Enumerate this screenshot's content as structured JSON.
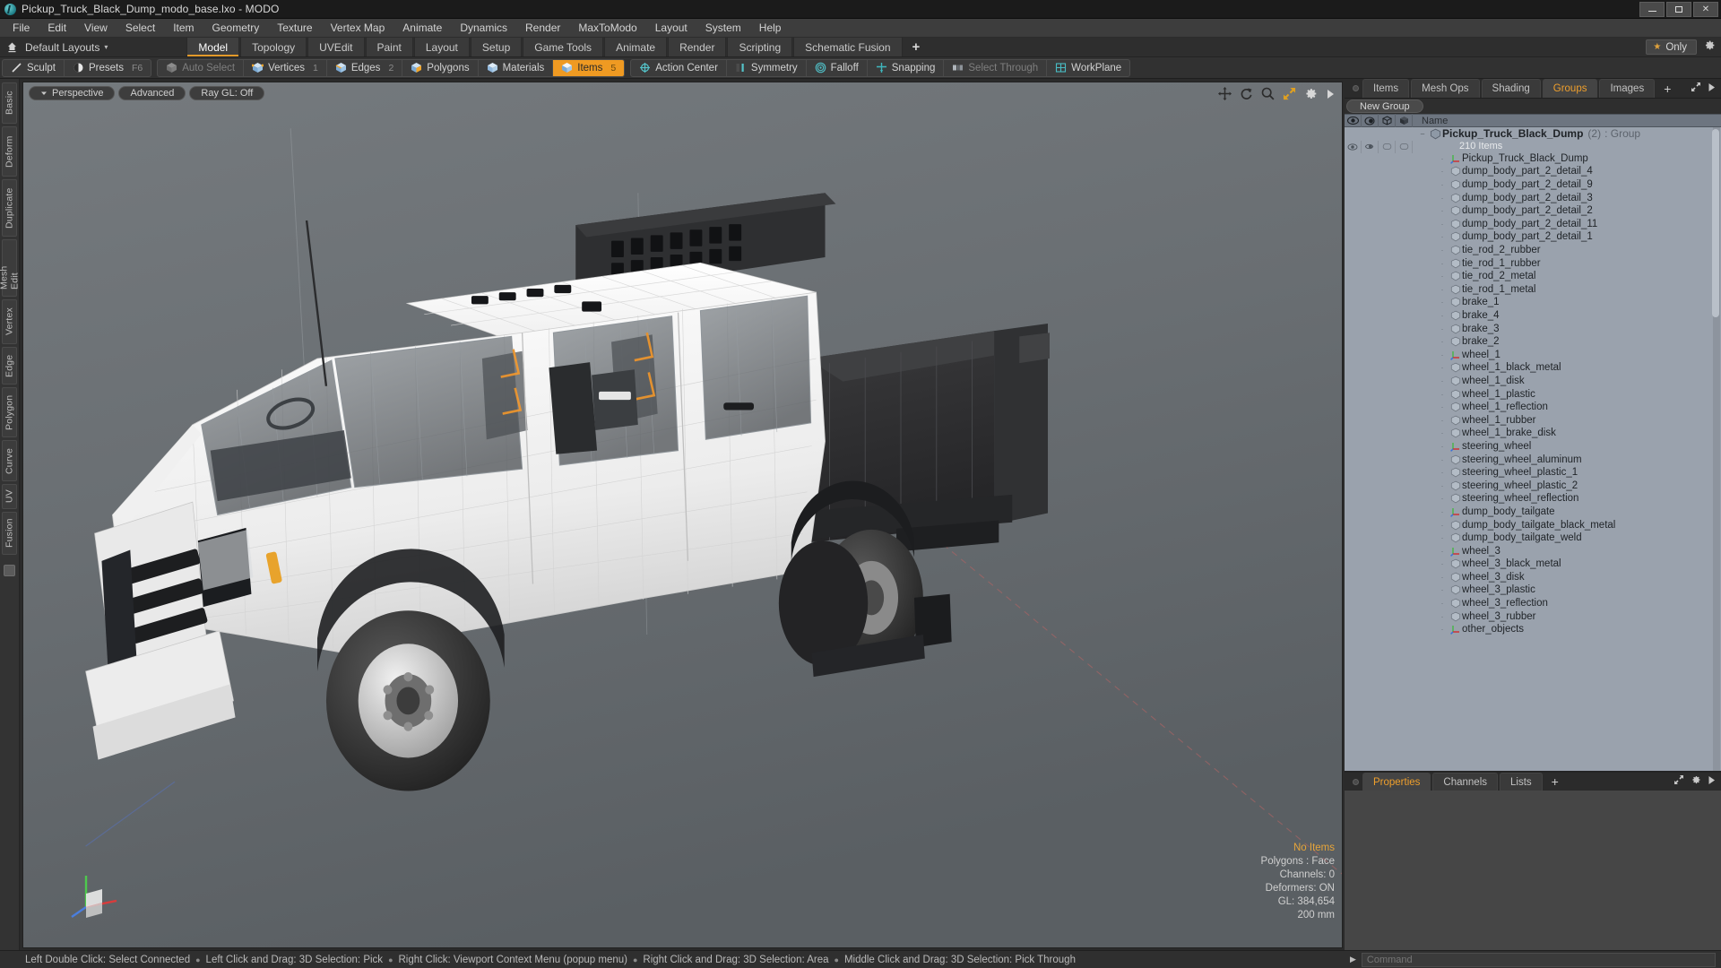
{
  "window": {
    "title": "Pickup_Truck_Black_Dump_modo_base.lxo - MODO",
    "app_icon": "modo-logo-icon",
    "minimize_label": "",
    "maximize_label": "",
    "close_label": "✕"
  },
  "menubar": {
    "items": [
      {
        "label": "File"
      },
      {
        "label": "Edit"
      },
      {
        "label": "View"
      },
      {
        "label": "Select"
      },
      {
        "label": "Item"
      },
      {
        "label": "Geometry"
      },
      {
        "label": "Texture"
      },
      {
        "label": "Vertex Map"
      },
      {
        "label": "Animate"
      },
      {
        "label": "Dynamics"
      },
      {
        "label": "Render"
      },
      {
        "label": "MaxToModo"
      },
      {
        "label": "Layout"
      },
      {
        "label": "System"
      },
      {
        "label": "Help"
      }
    ]
  },
  "layoutbar": {
    "home_icon": "home-icon",
    "layouts_label": "Default Layouts",
    "layouts_caret": "▾",
    "tabs": [
      {
        "label": "Model",
        "active": true
      },
      {
        "label": "Topology",
        "active": false
      },
      {
        "label": "UVEdit",
        "active": false
      },
      {
        "label": "Paint",
        "active": false
      },
      {
        "label": "Layout",
        "active": false
      },
      {
        "label": "Setup",
        "active": false
      },
      {
        "label": "Game Tools",
        "active": false
      },
      {
        "label": "Animate",
        "active": false
      },
      {
        "label": "Render",
        "active": false
      },
      {
        "label": "Scripting",
        "active": false
      },
      {
        "label": "Schematic Fusion",
        "active": false
      }
    ],
    "add_tab_label": "+",
    "only_label": "Only",
    "only_star": "★",
    "gear_icon": "gear-icon"
  },
  "modebar": {
    "groups": [
      {
        "buttons": [
          {
            "label": "Sculpt",
            "icon": "sculpt-pencil-icon",
            "shortcut": "",
            "state": "normal"
          },
          {
            "label": "Presets",
            "icon": "presets-sphere-icon",
            "shortcut": "F6",
            "state": "normal"
          }
        ]
      },
      {
        "buttons": [
          {
            "label": "Auto Select",
            "icon": "cube-grey-icon",
            "shortcut": "",
            "state": "dim"
          },
          {
            "label": "Vertices",
            "icon": "cube-vertices-icon",
            "shortcut": "1",
            "state": "normal"
          },
          {
            "label": "Edges",
            "icon": "cube-edges-icon",
            "shortcut": "2",
            "state": "normal"
          },
          {
            "label": "Polygons",
            "icon": "cube-polygons-icon",
            "shortcut": "",
            "state": "normal"
          },
          {
            "label": "Materials",
            "icon": "cube-materials-icon",
            "shortcut": "",
            "state": "normal"
          },
          {
            "label": "Items",
            "icon": "cube-items-icon",
            "shortcut": "5",
            "state": "selected"
          }
        ]
      },
      {
        "buttons": [
          {
            "label": "Action Center",
            "icon": "action-center-icon",
            "shortcut": "",
            "state": "normal"
          },
          {
            "label": "Symmetry",
            "icon": "symmetry-icon",
            "shortcut": "",
            "state": "normal"
          },
          {
            "label": "Falloff",
            "icon": "falloff-icon",
            "shortcut": "",
            "state": "normal"
          },
          {
            "label": "Snapping",
            "icon": "snapping-icon",
            "shortcut": "",
            "state": "normal"
          },
          {
            "label": "Select Through",
            "icon": "select-through-icon",
            "shortcut": "",
            "state": "dim"
          },
          {
            "label": "WorkPlane",
            "icon": "workplane-icon",
            "shortcut": "",
            "state": "normal"
          }
        ]
      }
    ]
  },
  "leftrail": {
    "tabs": [
      "Basic",
      "Deform",
      "Duplicate",
      "Mesh Edit",
      "Vertex",
      "Edge",
      "Polygon",
      "Curve",
      "UV",
      "Fusion"
    ]
  },
  "viewport": {
    "pills": [
      {
        "label": "Perspective",
        "icon": "chevron-down-icon"
      },
      {
        "label": "Advanced",
        "icon": ""
      },
      {
        "label": "Ray GL: Off",
        "icon": ""
      }
    ],
    "tools": [
      "move-icon",
      "rotate-icon",
      "zoom-search-icon",
      "fit-arrows-icon",
      "gear-icon",
      "play-arrow-icon"
    ],
    "stats": {
      "selection": "No Items",
      "polygons": "Polygons : Face",
      "channels": "Channels: 0",
      "deformers": "Deformers: ON",
      "gl": "GL: 384,654",
      "grid": "200 mm"
    }
  },
  "rightpanel": {
    "tabs": [
      {
        "label": "Items",
        "active": false
      },
      {
        "label": "Mesh Ops",
        "active": false
      },
      {
        "label": "Shading",
        "active": false
      },
      {
        "label": "Groups",
        "active": true
      },
      {
        "label": "Images",
        "active": false
      }
    ],
    "add_tab_label": "+",
    "expand_icon": "expand-icon",
    "play_icon": "play-arrow-icon",
    "new_group_label": "New Group",
    "list_header": {
      "col_visible": "eye-icon",
      "col_render": "render-icon",
      "col_wire": "wireframe-cube-icon",
      "col_shade": "shaded-cube-icon",
      "name": "Name"
    },
    "group": {
      "name": "Pickup_Truck_Black_Dump",
      "count": "(2)",
      "type": ": Group",
      "sub": "210 Items"
    },
    "items": [
      {
        "name": "Pickup_Truck_Black_Dump",
        "icon": "locator-axis-icon"
      },
      {
        "name": "dump_body_part_2_detail_4",
        "icon": "mesh-cube-icon"
      },
      {
        "name": "dump_body_part_2_detail_9",
        "icon": "mesh-cube-icon"
      },
      {
        "name": "dump_body_part_2_detail_3",
        "icon": "mesh-cube-icon"
      },
      {
        "name": "dump_body_part_2_detail_2",
        "icon": "mesh-cube-icon"
      },
      {
        "name": "dump_body_part_2_detail_11",
        "icon": "mesh-cube-icon"
      },
      {
        "name": "dump_body_part_2_detail_1",
        "icon": "mesh-cube-icon"
      },
      {
        "name": "tie_rod_2_rubber",
        "icon": "mesh-cube-icon"
      },
      {
        "name": "tie_rod_1_rubber",
        "icon": "mesh-cube-icon"
      },
      {
        "name": "tie_rod_2_metal",
        "icon": "mesh-cube-icon"
      },
      {
        "name": "tie_rod_1_metal",
        "icon": "mesh-cube-icon"
      },
      {
        "name": "brake_1",
        "icon": "mesh-cube-icon"
      },
      {
        "name": "brake_4",
        "icon": "mesh-cube-icon"
      },
      {
        "name": "brake_3",
        "icon": "mesh-cube-icon"
      },
      {
        "name": "brake_2",
        "icon": "mesh-cube-icon"
      },
      {
        "name": "wheel_1",
        "icon": "locator-axis-icon"
      },
      {
        "name": "wheel_1_black_metal",
        "icon": "mesh-cube-icon"
      },
      {
        "name": "wheel_1_disk",
        "icon": "mesh-cube-icon"
      },
      {
        "name": "wheel_1_plastic",
        "icon": "mesh-cube-icon"
      },
      {
        "name": "wheel_1_reflection",
        "icon": "mesh-cube-icon"
      },
      {
        "name": "wheel_1_rubber",
        "icon": "mesh-cube-icon"
      },
      {
        "name": "wheel_1_brake_disk",
        "icon": "mesh-cube-icon"
      },
      {
        "name": "steering_wheel",
        "icon": "locator-axis-icon"
      },
      {
        "name": "steering_wheel_aluminum",
        "icon": "mesh-cube-icon"
      },
      {
        "name": "steering_wheel_plastic_1",
        "icon": "mesh-cube-icon"
      },
      {
        "name": "steering_wheel_plastic_2",
        "icon": "mesh-cube-icon"
      },
      {
        "name": "steering_wheel_reflection",
        "icon": "mesh-cube-icon"
      },
      {
        "name": "dump_body_tailgate",
        "icon": "locator-axis-icon"
      },
      {
        "name": "dump_body_tailgate_black_metal",
        "icon": "mesh-cube-icon"
      },
      {
        "name": "dump_body_tailgate_weld",
        "icon": "mesh-cube-icon"
      },
      {
        "name": "wheel_3",
        "icon": "locator-axis-icon"
      },
      {
        "name": "wheel_3_black_metal",
        "icon": "mesh-cube-icon"
      },
      {
        "name": "wheel_3_disk",
        "icon": "mesh-cube-icon"
      },
      {
        "name": "wheel_3_plastic",
        "icon": "mesh-cube-icon"
      },
      {
        "name": "wheel_3_reflection",
        "icon": "mesh-cube-icon"
      },
      {
        "name": "wheel_3_rubber",
        "icon": "mesh-cube-icon"
      },
      {
        "name": "other_objects",
        "icon": "locator-axis-icon"
      }
    ]
  },
  "properties": {
    "tabs": [
      {
        "label": "Properties",
        "active": true
      },
      {
        "label": "Channels",
        "active": false
      },
      {
        "label": "Lists",
        "active": false
      }
    ],
    "add_tab_label": "+",
    "expand_icon": "expand-icon",
    "gear_icon": "gear-icon",
    "play_icon": "play-arrow-icon"
  },
  "statusbar": {
    "hints": [
      "Left Double Click: Select Connected",
      "Left Click and Drag: 3D Selection: Pick",
      "Right Click: Viewport Context Menu (popup menu)",
      "Right Click and Drag: 3D Selection: Area",
      "Middle Click and Drag: 3D Selection: Pick Through"
    ],
    "separator": "●",
    "command_label": "Command",
    "command_value": "",
    "command_arrow": "▶"
  },
  "colors": {
    "accent_orange": "#ef9f2c",
    "panel_bg": "#2e2e2e",
    "list_bg": "#9aa2ad",
    "title_bg": "#1b1b1b"
  }
}
